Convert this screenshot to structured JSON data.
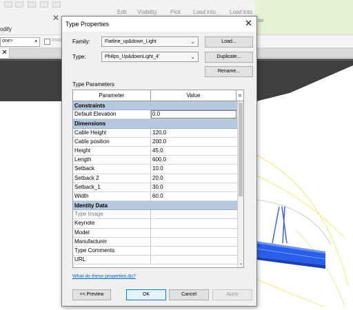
{
  "background_app": {
    "ribbon_labels": [
      "Edit",
      "Visibility",
      "Pick",
      "Load into",
      "Load into"
    ],
    "ribbon_partial_label": "se",
    "modify_label": "odify",
    "selector_value": "one>",
    "checkbox_label": "Insta",
    "tab_close": "✕"
  },
  "dialog": {
    "title": "Type Properties",
    "close_glyph": "✕",
    "family_label": "Family:",
    "family_value": "Flatline_up&down_Light",
    "type_label": "Type:",
    "type_value": "Philips_Up&downLight_4'",
    "load_button": "Load...",
    "duplicate_button": "Duplicate...",
    "rename_button": "Rename...",
    "type_parameters_label": "Type Parameters",
    "grid": {
      "col_parameter": "Parameter",
      "col_value": "Value",
      "col_eq": "=",
      "rows": [
        {
          "kind": "group",
          "label": "Constraints",
          "collapse": "⌃"
        },
        {
          "kind": "row",
          "param": "Default Elevation",
          "value": "0.0",
          "selected": true
        },
        {
          "kind": "group",
          "label": "Dimensions",
          "collapse": "⌃"
        },
        {
          "kind": "row",
          "param": "Cable Height",
          "value": "120.0"
        },
        {
          "kind": "row",
          "param": "Cable position",
          "value": "200.0"
        },
        {
          "kind": "row",
          "param": "Height",
          "value": "45.0"
        },
        {
          "kind": "row",
          "param": "Length",
          "value": "600.0"
        },
        {
          "kind": "row",
          "param": "Setback",
          "value": "10.0"
        },
        {
          "kind": "row",
          "param": "Setback 2",
          "value": "20.0"
        },
        {
          "kind": "row",
          "param": "Setback_1",
          "value": "30.0"
        },
        {
          "kind": "row",
          "param": "Width",
          "value": "60.0"
        },
        {
          "kind": "group",
          "label": "Identity Data",
          "collapse": "⌃"
        },
        {
          "kind": "row",
          "param": "Type Image",
          "value": "",
          "grey": true
        },
        {
          "kind": "row",
          "param": "Keynote",
          "value": ""
        },
        {
          "kind": "row",
          "param": "Model",
          "value": ""
        },
        {
          "kind": "row",
          "param": "Manufacturer",
          "value": ""
        },
        {
          "kind": "row",
          "param": "Type Comments",
          "value": ""
        },
        {
          "kind": "row",
          "param": "URL",
          "value": ""
        }
      ]
    },
    "scroll_down_glyph": "⌄",
    "help_link": "What do these properties do?",
    "preview_button": "<< Preview",
    "ok_button": "OK",
    "cancel_button": "Cancel",
    "apply_button": "Apply"
  }
}
